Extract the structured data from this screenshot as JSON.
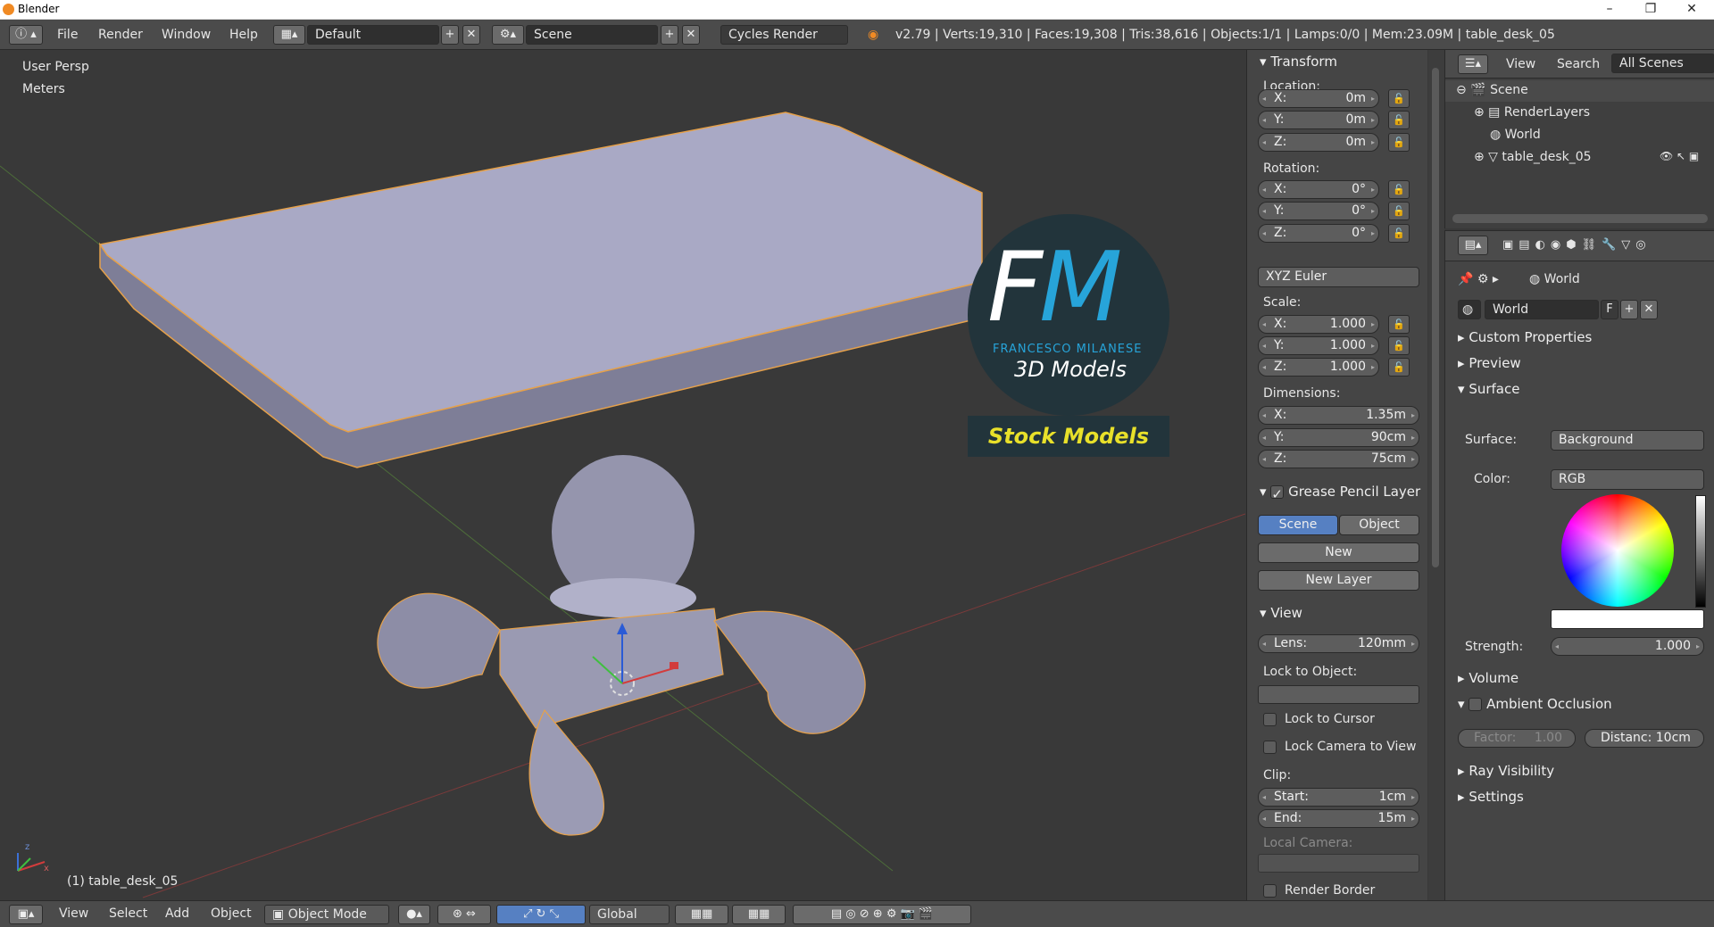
{
  "window": {
    "title": "Blender",
    "minimize": "–",
    "maximize": "❐",
    "close": "✕"
  },
  "menu": {
    "file": "File",
    "render": "Render",
    "window": "Window",
    "help": "Help"
  },
  "layout": {
    "name": "Default"
  },
  "scene": {
    "name": "Scene"
  },
  "engine": {
    "name": "Cycles Render"
  },
  "stats": "v2.79 | Verts:19,310 | Faces:19,308 | Tris:38,616 | Objects:1/1 | Lamps:0/0 | Mem:23.09M | table_desk_05",
  "viewport": {
    "persp": "User Persp",
    "units": "Meters",
    "active_object": "(1) table_desk_05",
    "axis_x": "x",
    "axis_z": "z",
    "logo": {
      "f": "F",
      "m": "M",
      "brand": "FRANCESCO MILANESE",
      "models": "3D Models",
      "stock": "Stock Models"
    }
  },
  "transform": {
    "title": "Transform",
    "location_label": "Location:",
    "location": [
      {
        "k": "X:",
        "v": "0m"
      },
      {
        "k": "Y:",
        "v": "0m"
      },
      {
        "k": "Z:",
        "v": "0m"
      }
    ],
    "rotation_label": "Rotation:",
    "rotation": [
      {
        "k": "X:",
        "v": "0°"
      },
      {
        "k": "Y:",
        "v": "0°"
      },
      {
        "k": "Z:",
        "v": "0°"
      }
    ],
    "rotation_mode": "XYZ Euler",
    "scale_label": "Scale:",
    "scale": [
      {
        "k": "X:",
        "v": "1.000"
      },
      {
        "k": "Y:",
        "v": "1.000"
      },
      {
        "k": "Z:",
        "v": "1.000"
      }
    ],
    "dimensions_label": "Dimensions:",
    "dimensions": [
      {
        "k": "X:",
        "v": "1.35m"
      },
      {
        "k": "Y:",
        "v": "90cm"
      },
      {
        "k": "Z:",
        "v": "75cm"
      }
    ]
  },
  "grease": {
    "title": "Grease Pencil Layer",
    "scene_tab": "Scene",
    "object_tab": "Object",
    "new": "New",
    "new_layer": "New Layer"
  },
  "view": {
    "title": "View",
    "lens_k": "Lens:",
    "lens_v": "120mm",
    "lock_object": "Lock to Object:",
    "lock_cursor": "Lock to Cursor",
    "lock_camera": "Lock Camera to View",
    "clip": "Clip:",
    "start_k": "Start:",
    "start_v": "1cm",
    "end_k": "End:",
    "end_v": "15m",
    "local_camera": "Local Camera:",
    "render_border": "Render Border"
  },
  "outliner": {
    "view": "View",
    "search": "Search",
    "filter": "All Scenes",
    "items": [
      "Scene",
      "RenderLayers",
      "World",
      "table_desk_05"
    ]
  },
  "properties": {
    "breadcrumb": "World",
    "world_name": "World",
    "fake_user": "F",
    "custom_properties": "Custom Properties",
    "preview": "Preview",
    "surface": "Surface",
    "surface_label": "Surface:",
    "surface_value": "Background",
    "color_label": "Color:",
    "color_value": "RGB",
    "strength_label": "Strength:",
    "strength_value": "1.000",
    "volume": "Volume",
    "ambient_occlusion": "Ambient Occlusion",
    "factor_k": "Factor:",
    "factor_v": "1.00",
    "distance": "Distanc: 10cm",
    "ray_visibility": "Ray Visibility",
    "settings": "Settings"
  },
  "bottom": {
    "view": "View",
    "select": "Select",
    "add": "Add",
    "object": "Object",
    "mode": "Object Mode",
    "orientation": "Global"
  },
  "colors": {
    "accent": "#5680c2",
    "selection": "#f2a341",
    "brand_blue": "#27a4d9",
    "brand_yellow": "#e8e02a"
  }
}
